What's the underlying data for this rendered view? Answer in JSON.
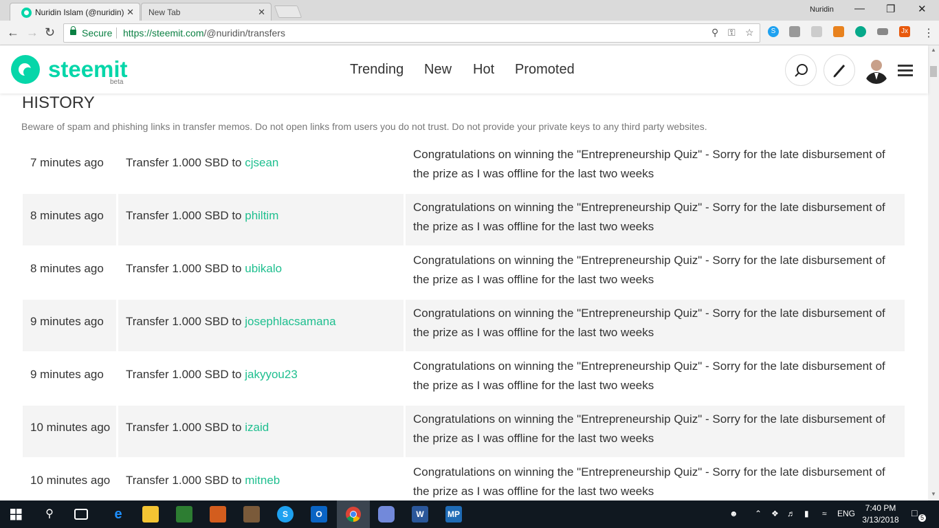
{
  "browser": {
    "tabs": [
      {
        "title": "Nuridin Islam (@nuridin)",
        "close": "✕"
      },
      {
        "title": "New Tab",
        "close": "✕"
      }
    ],
    "window_user": "Nuridin",
    "omnibox": {
      "secure_label": "Secure",
      "url_host": "https://steemit.com",
      "url_path": "/@nuridin/transfers"
    }
  },
  "site": {
    "logo_text": "steemit",
    "logo_beta": "beta",
    "nav": [
      "Trending",
      "New",
      "Hot",
      "Promoted"
    ],
    "brand_color": "#06d6a9",
    "link_color": "#1fbf8f"
  },
  "history": {
    "title": "HISTORY",
    "warning": "Beware of spam and phishing links in transfer memos. Do not open links from users you do not trust. Do not provide your private keys to any third party websites.",
    "transfer_prefix": "Transfer 1.000 SBD to ",
    "rows": [
      {
        "time": "7 minutes ago",
        "prefix": "Transfer 1.000 SBD to ",
        "user": "cjsean",
        "memo": "Congratulations on winning the \"Entrepreneurship Quiz\" - Sorry for the late disbursement of the prize as I was offline for the last two weeks"
      },
      {
        "time": "8 minutes ago",
        "prefix": "Transfer 1.000 SBD to ",
        "user": "philtim",
        "memo": "Congratulations on winning the \"Entrepreneurship Quiz\" - Sorry for the late disbursement of the prize as I was offline for the last two weeks"
      },
      {
        "time": "8 minutes ago",
        "prefix": "Transfer 1.000 SBD to ",
        "user": "ubikalo",
        "memo": "Congratulations on winning the \"Entrepreneurship Quiz\" - Sorry for the late disbursement of the prize as I was offline for the last two weeks"
      },
      {
        "time": "9 minutes ago",
        "prefix": "Transfer 1.000 SBD to ",
        "user": "josephlacsamana",
        "memo": "Congratulations on winning the \"Entrepreneurship Quiz\" - Sorry for the late disbursement of the prize as I was offline for the last two weeks"
      },
      {
        "time": "9 minutes ago",
        "prefix": "Transfer 1.000 SBD to ",
        "user": "jakyyou23",
        "memo": "Congratulations on winning the \"Entrepreneurship Quiz\" - Sorry for the late disbursement of the prize as I was offline for the last two weeks"
      },
      {
        "time": "10 minutes ago",
        "prefix": "Transfer 1.000 SBD to ",
        "user": "izaid",
        "memo": "Congratulations on winning the \"Entrepreneurship Quiz\" - Sorry for the late disbursement of the prize as I was offline for the last two weeks"
      },
      {
        "time": "10 minutes ago",
        "prefix": "Transfer 1.000 SBD to ",
        "user": "mitneb",
        "memo": "Congratulations on winning the \"Entrepreneurship Quiz\" - Sorry for the late disbursement of the prize as I was offline for the last two weeks"
      }
    ]
  },
  "taskbar": {
    "language": "ENG",
    "time": "7:40 PM",
    "date": "3/13/2018",
    "notifications": "5"
  }
}
